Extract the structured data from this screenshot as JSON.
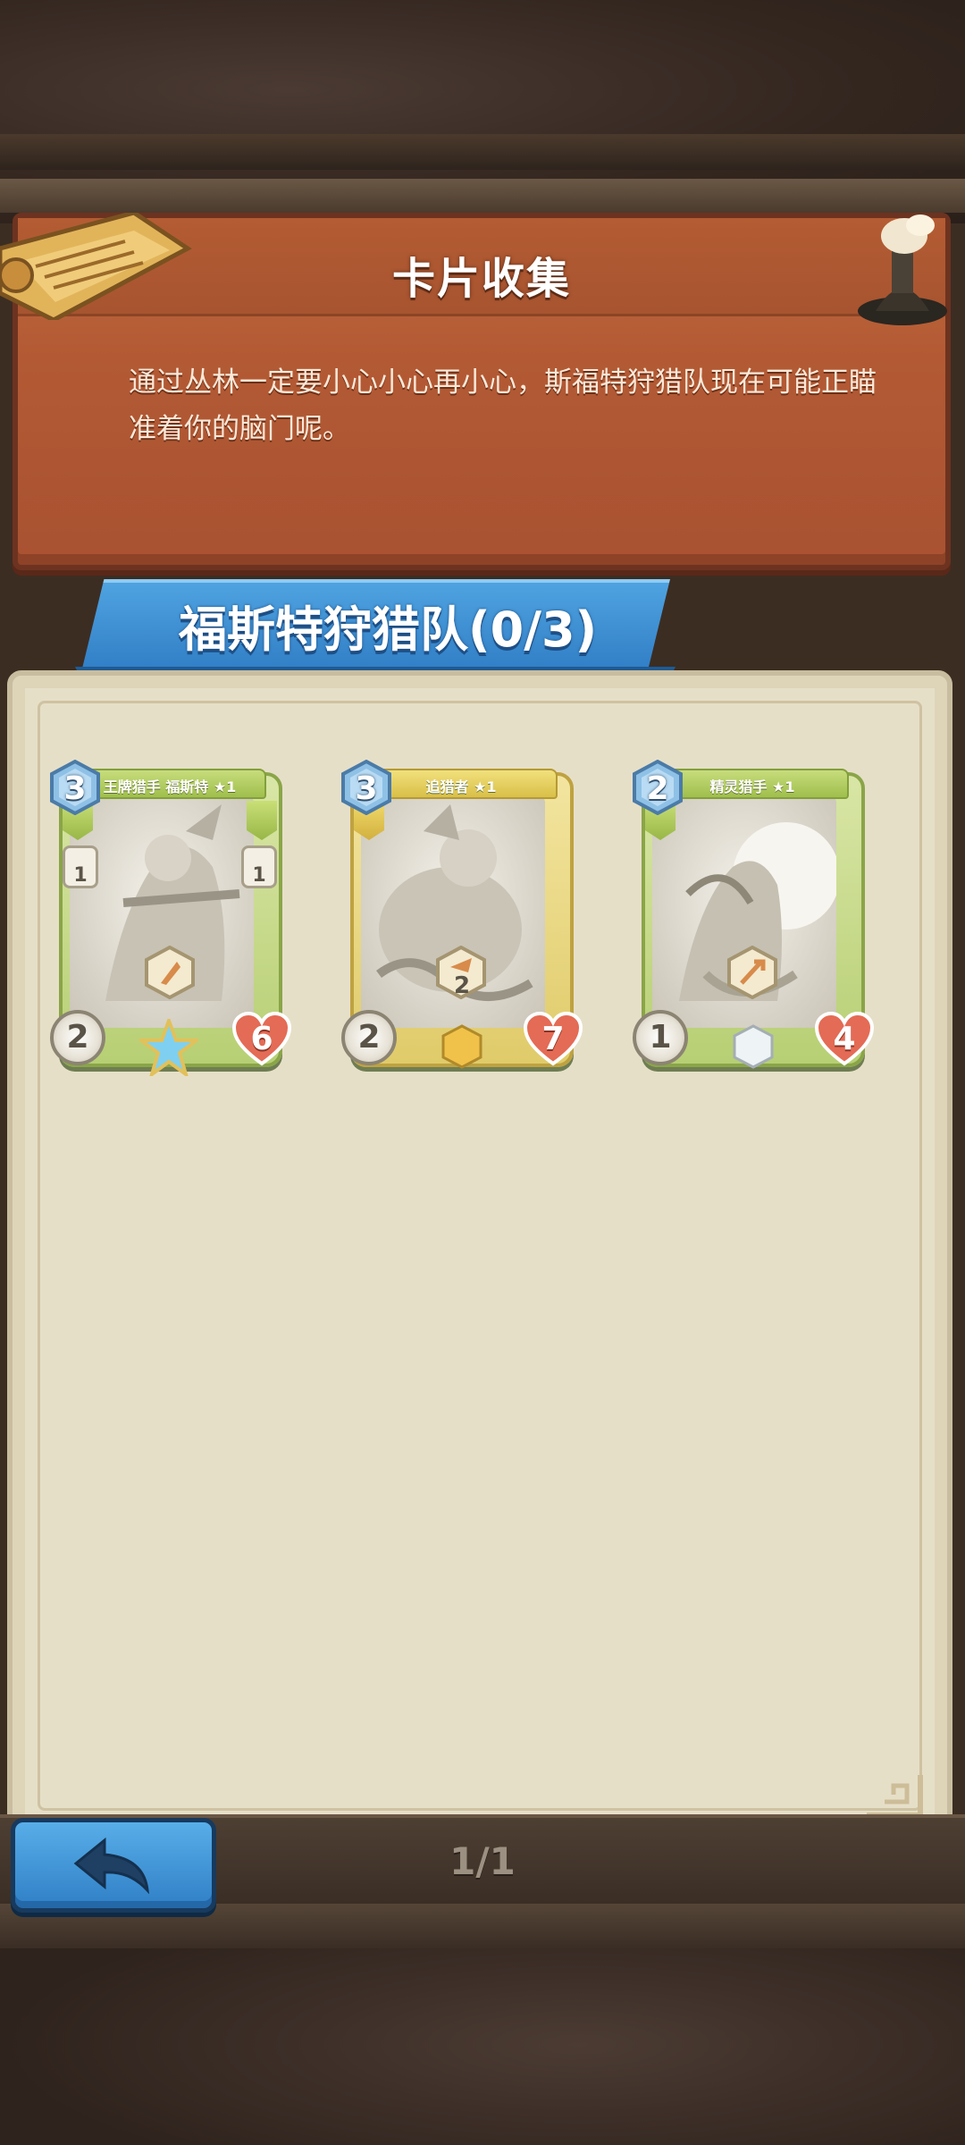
{
  "header": {
    "title": "卡片收集",
    "description": "通过丛林一定要小心小心再小心，斯福特狩猎队现在可能正瞄准着你的脑门呢。"
  },
  "set": {
    "title": "福斯特狩猎队(0/3)"
  },
  "cards": [
    {
      "name": "王牌猎手 福斯特 ★1",
      "cost": "3",
      "attack": "2",
      "health": "6",
      "side_left": "1",
      "side_right": "1",
      "skill_value": "",
      "rarity": "green-star",
      "frame": "green"
    },
    {
      "name": "追猎者 ★1",
      "cost": "3",
      "attack": "2",
      "health": "7",
      "side_left": "",
      "side_right": "",
      "skill_value": "2",
      "rarity": "gold",
      "frame": "gold"
    },
    {
      "name": "精灵猎手 ★1",
      "cost": "2",
      "attack": "1",
      "health": "4",
      "side_left": "",
      "side_right": "",
      "skill_value": "",
      "rarity": "white",
      "frame": "green"
    }
  ],
  "footer": {
    "back_icon": "back-arrow-icon",
    "page_indicator": "1/1"
  },
  "colors": {
    "header_orange": "#b35a34",
    "ribbon_blue": "#2f7cc4",
    "paper": "#e6dfc8",
    "back_button_blue": "#3f95d6",
    "health_red": "#d9604a"
  }
}
